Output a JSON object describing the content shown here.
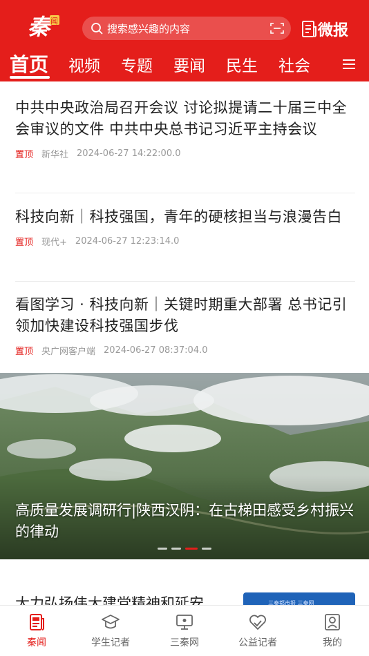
{
  "header": {
    "logo_text": "秦",
    "logo_sub": "闻",
    "search_placeholder": "搜索感兴趣的内容",
    "weibao_label": "微报",
    "brand_color": "#e41e1b"
  },
  "tabs": [
    {
      "label": "首页",
      "active": true
    },
    {
      "label": "视频"
    },
    {
      "label": "专题"
    },
    {
      "label": "要闻"
    },
    {
      "label": "民生"
    },
    {
      "label": "社会"
    }
  ],
  "news": [
    {
      "title": "中共中央政治局召开会议 讨论拟提请二十届三中全会审议的文件 中共中央总书记习近平主持会议",
      "tag": "置顶",
      "source": "新华社",
      "time": "2024-06-27 14:22:00.0"
    },
    {
      "title": "科技向新｜科技强国，青年的硬核担当与浪漫告白",
      "tag": "置顶",
      "source": "现代+",
      "time": "2024-06-27 12:23:14.0"
    },
    {
      "title": "看图学习 · 科技向新｜关键时期重大部署 总书记引领加快建设科技强国步伐",
      "tag": "置顶",
      "source": "央广网客户端",
      "time": "2024-06-27 08:37:04.0"
    }
  ],
  "banner": {
    "caption": "高质量发展调研行|陕西汉阴：在古梯田感受乡村振兴的律动",
    "dots": 4,
    "active_dot": 3
  },
  "partial_item": {
    "title": "大力弘扬伟大建党精神和延安",
    "thumb_text": "三秦都市报 三秦网"
  },
  "bottom_nav": [
    {
      "label": "秦闻",
      "icon": "news-icon",
      "active": true
    },
    {
      "label": "学生记者",
      "icon": "graduation-cap-icon"
    },
    {
      "label": "三秦网",
      "icon": "monitor-icon"
    },
    {
      "label": "公益记者",
      "icon": "heart-hands-icon"
    },
    {
      "label": "我的",
      "icon": "profile-icon"
    }
  ]
}
